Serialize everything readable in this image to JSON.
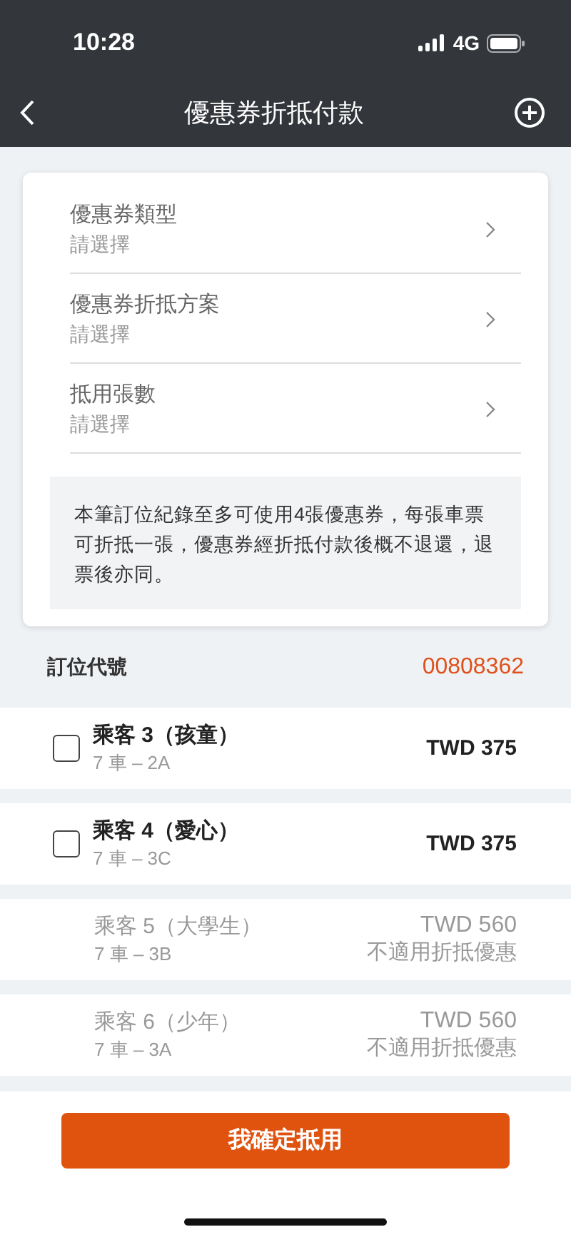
{
  "status_bar": {
    "time": "10:28",
    "network": "4G"
  },
  "nav": {
    "title": "優惠券折抵付款"
  },
  "form_fields": [
    {
      "label": "優惠券類型",
      "placeholder": "請選擇"
    },
    {
      "label": "優惠券折抵方案",
      "placeholder": "請選擇"
    },
    {
      "label": "抵用張數",
      "placeholder": "請選擇"
    }
  ],
  "notice": "本筆訂位紀錄至多可使用4張優惠券，每張車票可折抵一張，優惠券經折抵付款後概不退還，退票後亦同。",
  "booking": {
    "label": "訂位代號",
    "code": "00808362"
  },
  "passengers": [
    {
      "kind": "selectable",
      "checked": false,
      "name": "乘客 3（孩童）",
      "seat": "7 車 – 2A",
      "price": "TWD 375"
    },
    {
      "kind": "selectable",
      "checked": false,
      "name": "乘客 4（愛心）",
      "seat": "7 車 – 3C",
      "price": "TWD 375"
    },
    {
      "kind": "unavailable",
      "name": "乘客 5（大學生）",
      "seat": "7 車 – 3B",
      "price": "TWD 560",
      "note": "不適用折抵優惠"
    },
    {
      "kind": "unavailable",
      "name": "乘客 6（少年）",
      "seat": "7 車 – 3A",
      "price": "TWD 560",
      "note": "不適用折抵優惠"
    }
  ],
  "confirm_button": "我確定抵用"
}
